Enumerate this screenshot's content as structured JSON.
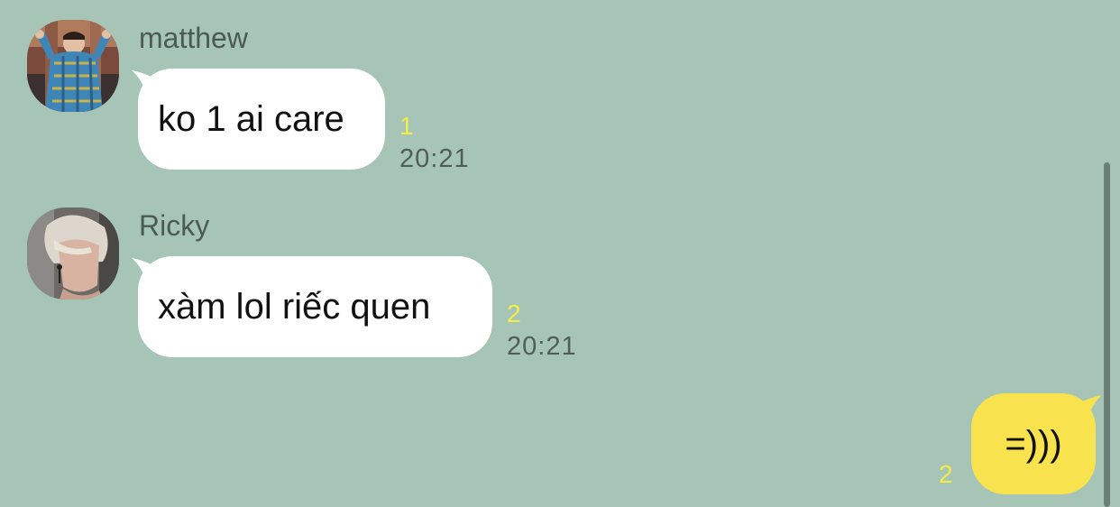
{
  "messages": [
    {
      "sender": "matthew",
      "text": "ko 1 ai care",
      "unread": "1",
      "time": "20:21",
      "avatar": "user-avatar-photo"
    },
    {
      "sender": "Ricky",
      "text": "xàm lol riếc quen",
      "unread": "2",
      "time": "20:21",
      "avatar": "user-avatar-photo"
    }
  ],
  "my_messages": [
    {
      "text": "=)))",
      "unread": "2"
    }
  ],
  "colors": {
    "background": "#a7c5b6",
    "incoming_bubble": "#ffffff",
    "outgoing_bubble": "#f8e34f",
    "unread_count": "#f3ec4a"
  }
}
